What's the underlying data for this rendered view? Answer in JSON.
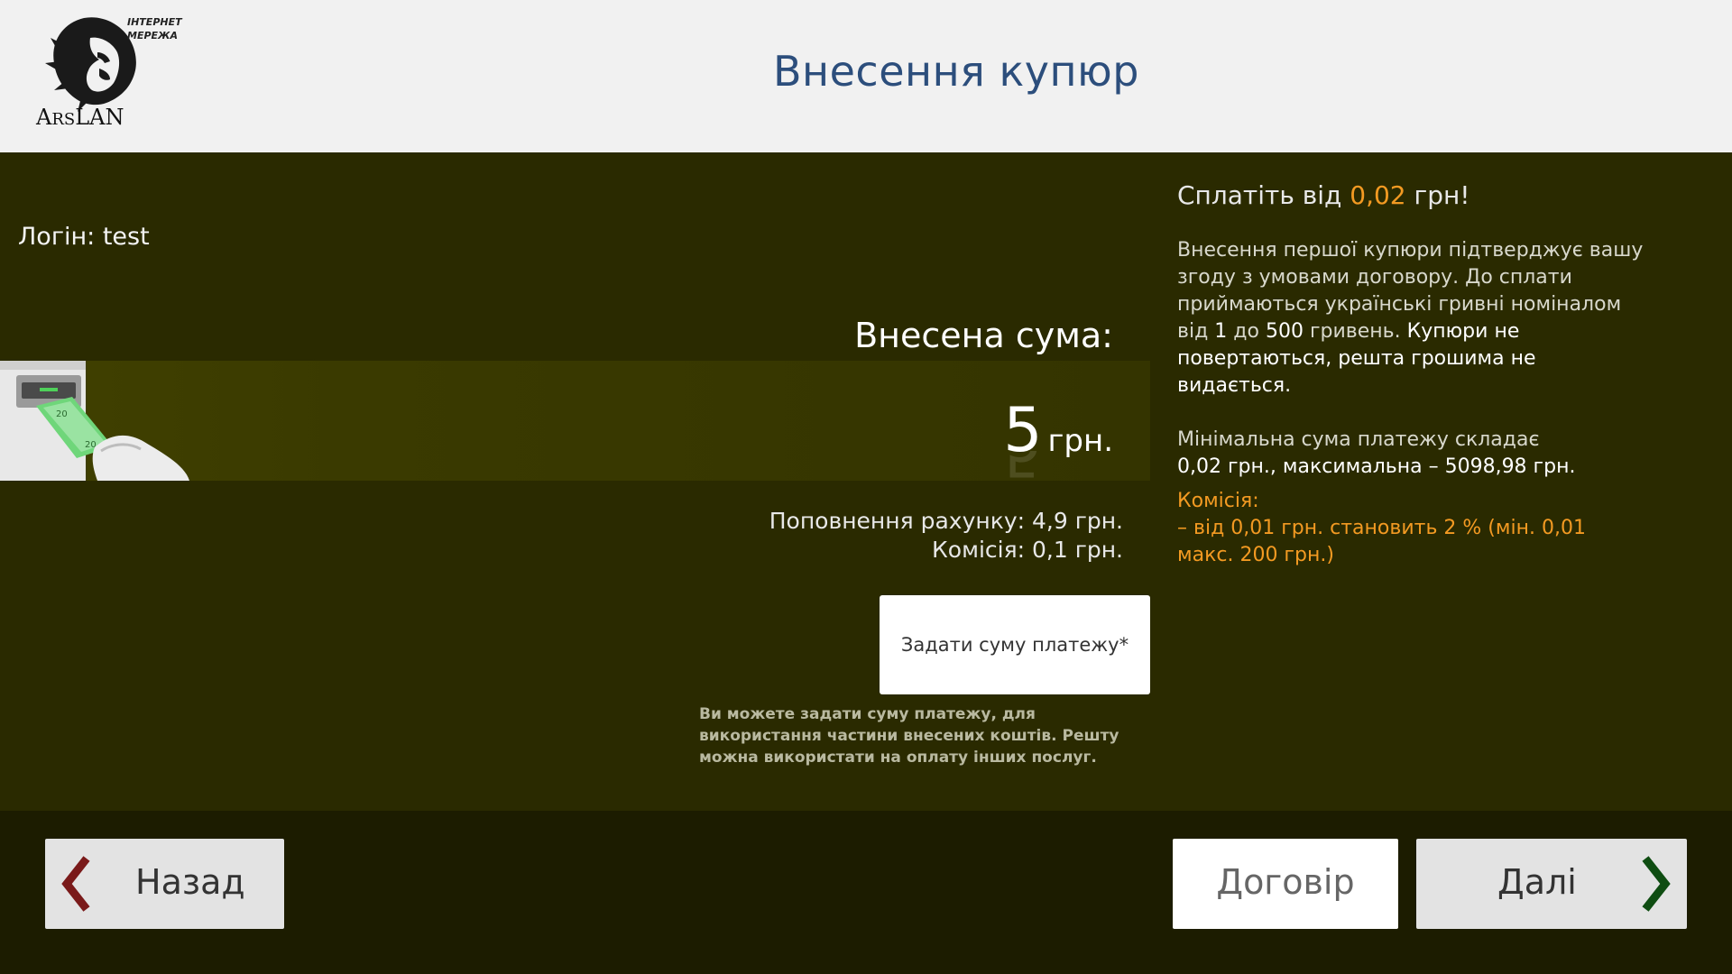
{
  "header": {
    "title": "Внесення купюр",
    "logo_tag": "ІНТЕРНЕТ МЕРЕЖА",
    "logo_name_part1": "A",
    "logo_name_part2": "RS",
    "logo_name_part3": "LAN"
  },
  "login": {
    "label": "Логін: test"
  },
  "deposit": {
    "inserted_label": "Внесена сума:",
    "amount": "5",
    "currency": "грн.",
    "account_topup": "Поповнення рахунку: 4,9 грн.",
    "commission": "Комісія: 0,1 грн."
  },
  "set_sum": {
    "button_label": "Задати суму платежу*",
    "note": "Ви можете задати суму платежу, для використання частини внесених коштів. Решту можна використати на оплату інших послуг."
  },
  "info": {
    "pay_from_prefix": "Сплатіть від",
    "pay_from_value": "0,02",
    "pay_from_suffix": "грн!",
    "desc_part1": "Внесення першої купюри підтверджує вашу згоду з умовами договору. До сплати приймаються українські гривні номіналом від",
    "desc_n1": "1",
    "desc_to": "до",
    "desc_n2": "500",
    "desc_part2": "гривень.",
    "desc_white": "Купюри не повертаються, решта грошима не видається.",
    "min_line1": "Мінімальна сума платежу складає",
    "min_line2": "0,02 грн., максимальна – 5098,98 грн.",
    "commission_title": "Комісія:",
    "commission_text": "– від 0,01 грн. становить 2 % (мін. 0,01 макс. 200 грн.)"
  },
  "footer": {
    "back_label": "Назад",
    "contract_label": "Договір",
    "next_label": "Далі"
  },
  "colors": {
    "title": "#2c4e7c",
    "accent_orange": "#f39a22",
    "content_bg": "#2a2a00",
    "back_chevron": "#7a1a1a",
    "next_chevron": "#0f4d12"
  }
}
